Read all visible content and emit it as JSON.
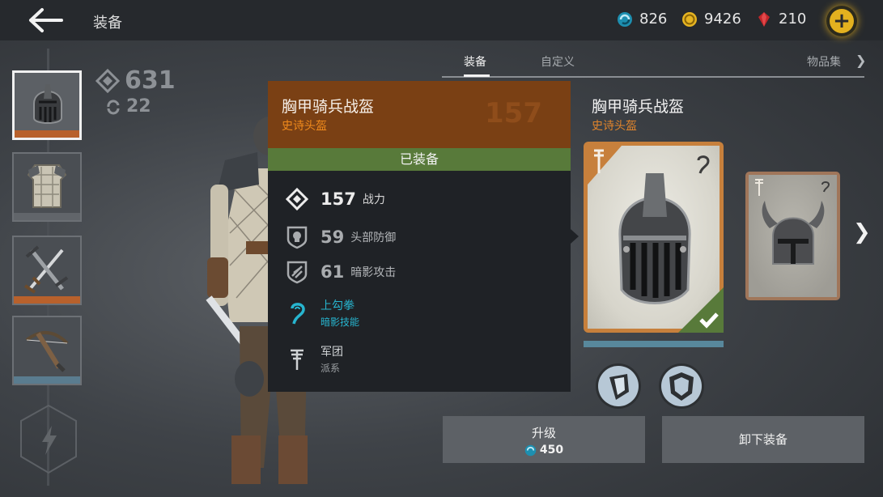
{
  "header": {
    "title": "装备",
    "currencies": [
      {
        "name": "gem",
        "value": "826"
      },
      {
        "name": "coin",
        "value": "9426"
      },
      {
        "name": "ruby",
        "value": "210"
      }
    ],
    "add_label": "+"
  },
  "left_stats": {
    "power": "631",
    "upgrades": "22"
  },
  "slots": [
    {
      "name": "helmet",
      "bar_color": "#b8612c"
    },
    {
      "name": "armor",
      "bar_color": "#61656a"
    },
    {
      "name": "weapons",
      "bar_color": "#b8612c"
    },
    {
      "name": "ranged",
      "bar_color": "#5a7c8f"
    }
  ],
  "tabs": [
    {
      "label": "装备",
      "active": true
    },
    {
      "label": "自定义",
      "active": false
    },
    {
      "label": "物品集",
      "active": false
    }
  ],
  "item": {
    "name": "胸甲骑兵战盔",
    "rarity": "史诗头盔",
    "ghost_power": "157"
  },
  "popup": {
    "name": "胸甲骑兵战盔",
    "rarity": "史诗头盔",
    "ghost_power": "157",
    "equipped": "已装备",
    "stats": {
      "power": {
        "value": "157",
        "label": "战力"
      },
      "head_defense": {
        "value": "59",
        "label": "头部防御"
      },
      "shadow_attack": {
        "value": "61",
        "label": "暗影攻击"
      }
    },
    "skill": {
      "name": "上勾拳",
      "type": "暗影技能"
    },
    "faction": {
      "name": "军团",
      "type": "派系"
    }
  },
  "actions": {
    "upgrade_label": "升级",
    "upgrade_cost": "450",
    "unequip_label": "卸下装备"
  },
  "colors": {
    "epic": "#e0842c",
    "equipped": "#587a3a",
    "skill": "#27b5cf",
    "gold": "#e3b11f"
  }
}
